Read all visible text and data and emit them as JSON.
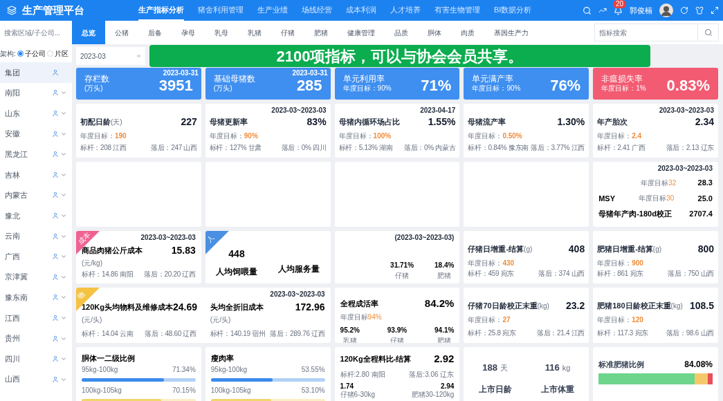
{
  "header": {
    "title": "生产管理平台",
    "nav": [
      {
        "label": "生产指标分析",
        "selected": true
      },
      {
        "label": "猪舍利用管理",
        "selected": false
      },
      {
        "label": "生产业绩",
        "selected": false
      },
      {
        "label": "场线经营",
        "selected": false
      },
      {
        "label": "成本利润",
        "selected": false
      },
      {
        "label": "人才培养",
        "selected": false
      },
      {
        "label": "有害生物管理",
        "selected": false
      },
      {
        "label": "BI数据分析",
        "selected": false
      }
    ],
    "badge": "20",
    "user": "郭俊楠"
  },
  "sidebar": {
    "placeholder": "搜索区域/子公司...",
    "structure_label": "架构:",
    "radios": [
      {
        "label": "子公司",
        "selected": true
      },
      {
        "label": "片区",
        "selected": false
      }
    ],
    "regions": [
      {
        "name": "集团",
        "selected": true,
        "expandable": false
      },
      {
        "name": "南阳",
        "selected": false,
        "expandable": true
      },
      {
        "name": "山东",
        "selected": false,
        "expandable": true
      },
      {
        "name": "安徽",
        "selected": false,
        "expandable": true
      },
      {
        "name": "黑龙江",
        "selected": false,
        "expandable": true
      },
      {
        "name": "吉林",
        "selected": false,
        "expandable": true
      },
      {
        "name": "内蒙古",
        "selected": false,
        "expandable": true
      },
      {
        "name": "豫北",
        "selected": false,
        "expandable": true
      },
      {
        "name": "云南",
        "selected": false,
        "expandable": true
      },
      {
        "name": "广西",
        "selected": false,
        "expandable": true
      },
      {
        "name": "京津冀",
        "selected": false,
        "expandable": true
      },
      {
        "name": "豫东南",
        "selected": false,
        "expandable": true
      },
      {
        "name": "江西",
        "selected": false,
        "expandable": true
      },
      {
        "name": "贵州",
        "selected": false,
        "expandable": true
      },
      {
        "name": "四川",
        "selected": false,
        "expandable": true
      },
      {
        "name": "山西",
        "selected": false,
        "expandable": true
      }
    ]
  },
  "subtabs": [
    {
      "label": "总览",
      "selected": true
    },
    {
      "label": "公猪",
      "selected": false
    },
    {
      "label": "后备",
      "selected": false
    },
    {
      "label": "孕母",
      "selected": false
    },
    {
      "label": "乳母",
      "selected": false
    },
    {
      "label": "乳猪",
      "selected": false
    },
    {
      "label": "仔猪",
      "selected": false
    },
    {
      "label": "肥猪",
      "selected": false
    },
    {
      "label": "健康管理",
      "selected": false
    },
    {
      "label": "品质",
      "selected": false
    },
    {
      "label": "胴体",
      "selected": false
    },
    {
      "label": "肉质",
      "selected": false
    },
    {
      "label": "基因生产力",
      "selected": false
    }
  ],
  "indicator_search": {
    "placeholder": "指标搜索"
  },
  "date_field": {
    "value": "2023-03"
  },
  "banner": "2100项指标，可以与协会会员共享。",
  "cards": [
    {
      "kind": "kpi",
      "color": "#3f8ff0",
      "title": "存栏数",
      "sub": "(万头)",
      "value": "3951",
      "date": "2023-03-31"
    },
    {
      "kind": "kpi",
      "color": "#3f8ff0",
      "title": "基础母猪数",
      "sub": "(万头)",
      "value": "285",
      "date": "2023-03-31"
    },
    {
      "kind": "kpi",
      "color": "#3f8ff0",
      "title": "单元利用率",
      "sub": "年度目标：90%",
      "value": "71%"
    },
    {
      "kind": "kpi",
      "color": "#3f8ff0",
      "title": "单元满产率",
      "sub": "年度目标：90%",
      "value": "76%"
    },
    {
      "kind": "kpi",
      "color": "#f25b72",
      "title": "非瘟损失率",
      "sub": "年度目标：1%",
      "value": "0.83%"
    },
    {
      "kind": "metric",
      "title": "初配日龄",
      "unit": "(天)",
      "value": "227",
      "target_label": "年度目标：",
      "target": "190",
      "benchmark": "标杆：208 江西",
      "lag": "落后：247 山西"
    },
    {
      "kind": "metric",
      "date": "2023-03~2023-03",
      "title": "母猪更新率",
      "value": "83%",
      "target_label": "年度目标：",
      "target": "90%",
      "benchmark": "标杆：127% 甘肃",
      "lag": "落后：0% 四川"
    },
    {
      "kind": "metric",
      "date": "2023-04-17",
      "title": "母猪内循环场占比",
      "value": "1.55%",
      "target_label": "年度目标：",
      "target": "100%",
      "benchmark": "标杆：5.13% 湖南",
      "lag": "落后：0% 内蒙古"
    },
    {
      "kind": "metric",
      "title": "母猪流产率",
      "value": "1.30%",
      "target_label": "年度目标：",
      "target": "0.50%",
      "benchmark": "标杆：0.84% 豫东南",
      "lag": "落后：3.77% 江西"
    },
    {
      "kind": "metric",
      "date": "2023-03~2023-03",
      "title": "年产胎次",
      "value": "2.34",
      "target_label": "年度目标：",
      "target": "2.4",
      "benchmark": "标杆：2.41 广西",
      "lag": "落后：2.13 辽东"
    },
    {
      "kind": "blank"
    },
    {
      "kind": "blank"
    },
    {
      "kind": "blank"
    },
    {
      "kind": "blank"
    },
    {
      "kind": "list",
      "date": "2023-03~2023-03",
      "rows": [
        {
          "target_label": "年度目标",
          "target": "32",
          "value": "28.3"
        },
        {
          "label": "MSY",
          "target_label": "年度目标",
          "target": "30",
          "value": "25.0"
        },
        {
          "label": "母猪年产肉-180d校正",
          "value": "2707.4"
        }
      ]
    },
    {
      "kind": "cost",
      "tag": {
        "text": "成本",
        "color": "#f06292"
      },
      "date": "2023-03~2023-03",
      "title": "商品肉猪公斤成本",
      "unit": "(元/kg)",
      "value": "15.83",
      "benchmark": "标杆：14.86 南阳",
      "lag": "落后：20.20 辽西"
    },
    {
      "kind": "staff",
      "tag": {
        "text": "人",
        "color": "#4a90e2"
      },
      "values": [
        {
          "value": "448",
          "label": "人均饲喂量"
        },
        {
          "label": "人均服务量"
        }
      ]
    },
    {
      "kind": "split",
      "date": "(2023-03~2023-03)",
      "values": [
        {
          "value": "31.71%",
          "label": "仔猪"
        },
        {
          "value": "18.4%",
          "label": "肥猪"
        }
      ]
    },
    {
      "kind": "metric",
      "title": "仔猪日增重-结算",
      "unit": "(g)",
      "value": "408",
      "target_label": "年度目标：",
      "target": "430",
      "benchmark": "标杆：459 宛东",
      "lag": "落后：374 山西"
    },
    {
      "kind": "metric",
      "title": "肥猪日增重-结算",
      "unit": "(g)",
      "value": "800",
      "target_label": "年度目标：",
      "target": "900",
      "benchmark": "标杆：861 宛东",
      "lag": "落后：750 山西"
    },
    {
      "kind": "pair",
      "tag": {
        "text": "物",
        "color": "#f5c242"
      },
      "date": "2023-03~2023-03",
      "items": [
        {
          "title": "120Kg头均物料及维修成本",
          "unit": "(元/头)",
          "value": "24.69",
          "benchmark": "标杆：14.04 云南",
          "lag": "落后：48.60 辽西"
        },
        {
          "title": "头均全折旧成本",
          "unit": "(元/头)",
          "value": "172.96",
          "benchmark": "标杆：140.19 宿州",
          "lag": "落后：289.76 辽西"
        }
      ]
    },
    {
      "kind": "survival",
      "title": "全程成活率",
      "value": "84.2%",
      "target_label": "年度目标",
      "target": "94%",
      "values": [
        {
          "value": "95.2%",
          "label": "乳猪"
        },
        {
          "value": "93.9%",
          "label": "仔猪"
        },
        {
          "value": "94.1%",
          "label": "肥猪"
        }
      ]
    },
    {
      "kind": "metric",
      "title": "仔猪70日龄校正末重",
      "unit": "(kg)",
      "value": "23.2",
      "target_label": "年度目标：",
      "target": "27",
      "benchmark": "标杆：25.8 宛东",
      "lag": "落后：21.4 江西"
    },
    {
      "kind": "metric",
      "title": "肥猪180日龄校正末重",
      "unit": "(kg)",
      "value": "108.5",
      "target_label": "年度目标：",
      "target": "120",
      "benchmark": "标杆：117.3 宛东",
      "lag": "落后：98.6 山西"
    },
    {
      "kind": "bars",
      "title": "胴体一二级比例",
      "rows": [
        {
          "range": "95kg-100kg",
          "value": "71.34%",
          "level": 0.72,
          "color": "#3b8beb"
        },
        {
          "range": "100kg-105kg",
          "value": "70.15%",
          "level": 0.7,
          "color": "#f2d56b"
        }
      ]
    },
    {
      "kind": "bars",
      "title": "瘦肉率",
      "rows": [
        {
          "range": "95kg-100kg",
          "value": "53.55%",
          "level": 0.54,
          "color": "#3b8beb"
        },
        {
          "range": "100kg-105kg",
          "value": "53.10%",
          "level": 0.53,
          "color": "#f2d56b"
        }
      ]
    },
    {
      "kind": "feed",
      "title": "120Kg全程料比-结算",
      "value": "2.92",
      "benchmark": "标杆:2.80 南阳",
      "lag": "落后:3.06 辽东",
      "rows": [
        {
          "value": "1.74",
          "label": "仔猪6-30kg"
        },
        {
          "value": "2.94",
          "label": "肥猪30-120kg"
        }
      ]
    },
    {
      "kind": "market",
      "items": [
        {
          "value": "188",
          "unit": "天",
          "label": "上市日龄"
        },
        {
          "value": "116",
          "unit": "kg",
          "label": "上市体重"
        }
      ]
    },
    {
      "kind": "ratio",
      "title": "标准肥猪比例",
      "value": "84.08%",
      "level": 0.84
    }
  ]
}
